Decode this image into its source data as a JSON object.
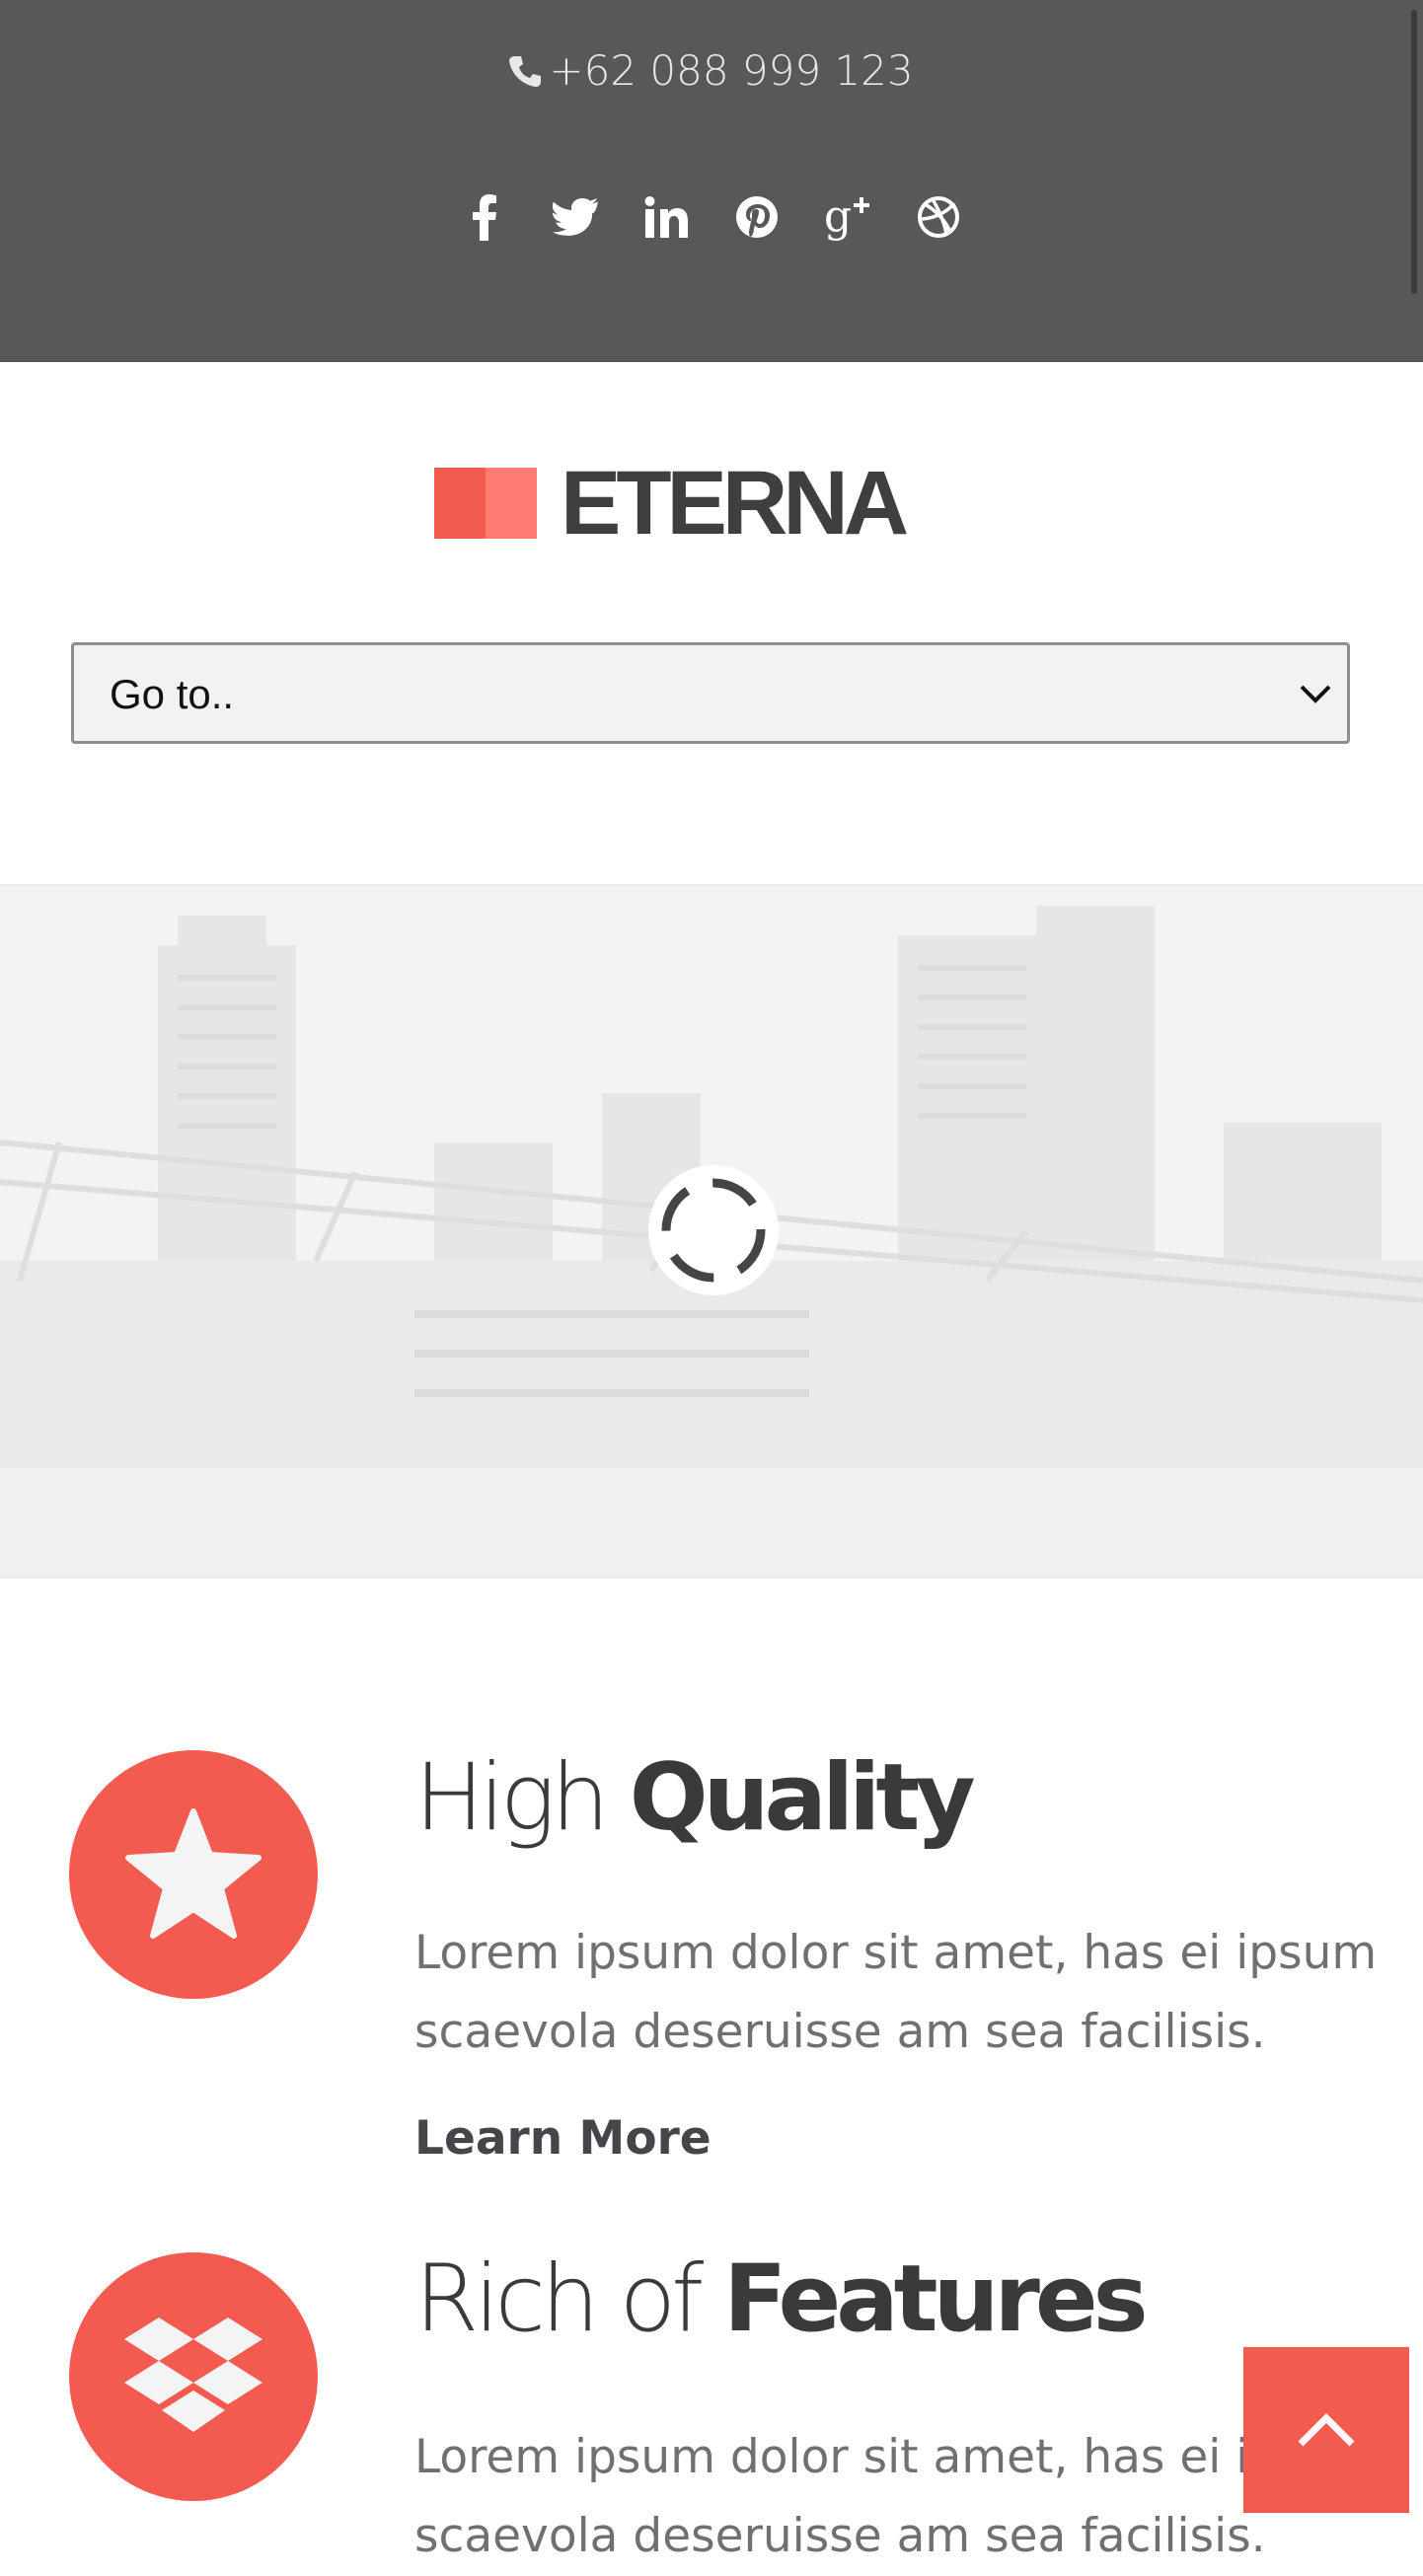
{
  "topbar": {
    "phone": "+62 088 999 123",
    "phone_icon": "phone-icon",
    "socials": [
      "facebook-icon",
      "twitter-icon",
      "linkedin-icon",
      "pinterest-icon",
      "google-plus-icon",
      "dribbble-icon"
    ]
  },
  "header": {
    "logo_text": "ETERNA",
    "brand_colors": [
      "#f45b50",
      "#ff7b71"
    ],
    "nav_select": {
      "value": "Go to..",
      "icon": "chevron-down-icon"
    }
  },
  "slider": {
    "background": "city-skyline-image",
    "loading_icon": "loading-spinner-icon"
  },
  "features": [
    {
      "icon": "star-icon",
      "title_light": "High",
      "title_bold": "Quality",
      "description": "Lorem ipsum dolor sit amet, has ei ipsum scaevola deseruisse am sea facilisis.",
      "link": "Learn More"
    },
    {
      "icon": "dropbox-icon",
      "title_light": "Rich of",
      "title_bold": "Features",
      "description": "Lorem ipsum dolor sit amet, has ei ipsum scaevola deseruisse am sea facilisis."
    }
  ],
  "back_to_top": {
    "icon": "chevron-up-icon"
  },
  "colors": {
    "accent": "#f45b50",
    "topbar": "#58585a",
    "text_dark": "#3a3a3c"
  }
}
